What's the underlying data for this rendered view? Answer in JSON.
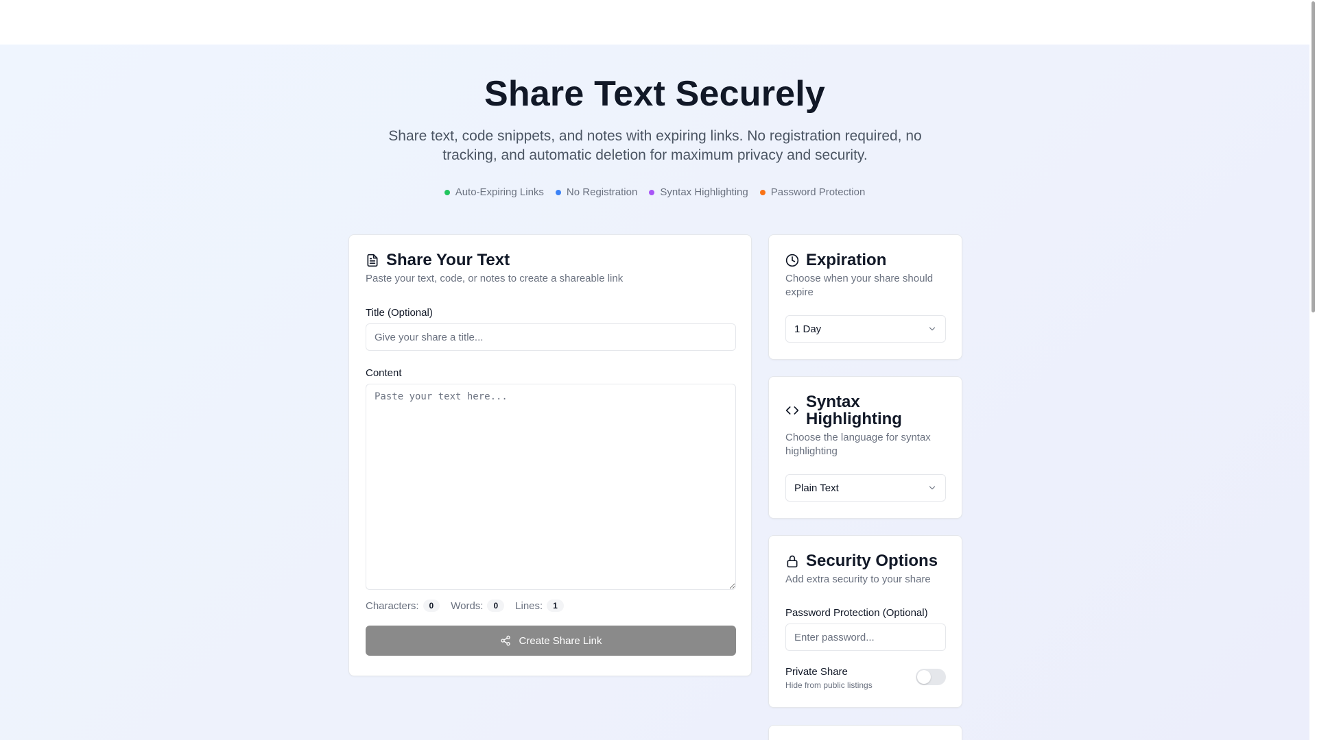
{
  "hero": {
    "title": "Share Text Securely",
    "description": "Share text, code snippets, and notes with expiring links. No registration required, no tracking, and automatic deletion for maximum privacy and security.",
    "features": [
      {
        "label": "Auto-Expiring Links",
        "color": "#22c55e"
      },
      {
        "label": "No Registration",
        "color": "#3b82f6"
      },
      {
        "label": "Syntax Highlighting",
        "color": "#a855f7"
      },
      {
        "label": "Password Protection",
        "color": "#f97316"
      }
    ]
  },
  "share_card": {
    "icon": "document-icon",
    "title": "Share Your Text",
    "subtitle": "Paste your text, code, or notes to create a shareable link",
    "title_label": "Title (Optional)",
    "title_placeholder": "Give your share a title...",
    "content_label": "Content",
    "content_placeholder": "Paste your text here...",
    "stats": {
      "characters_label": "Characters:",
      "characters": "0",
      "words_label": "Words:",
      "words": "0",
      "lines_label": "Lines:",
      "lines": "1"
    },
    "create_button": "Create Share Link",
    "create_icon": "share-icon"
  },
  "expiration_card": {
    "icon": "clock-icon",
    "title": "Expiration",
    "subtitle": "Choose when your share should expire",
    "selected": "1 Day"
  },
  "syntax_card": {
    "icon": "code-icon",
    "title": "Syntax Highlighting",
    "subtitle": "Choose the language for syntax highlighting",
    "selected": "Plain Text"
  },
  "security_card": {
    "icon": "lock-icon",
    "title": "Security Options",
    "subtitle": "Add extra security to your share",
    "password_label": "Password Protection (Optional)",
    "password_placeholder": "Enter password...",
    "private_label": "Private Share",
    "private_hint": "Hide from public listings",
    "private_enabled": false
  },
  "colors": {
    "accent_button": "#8a8a8a",
    "text_primary": "#111827",
    "text_muted": "#6b7280"
  }
}
